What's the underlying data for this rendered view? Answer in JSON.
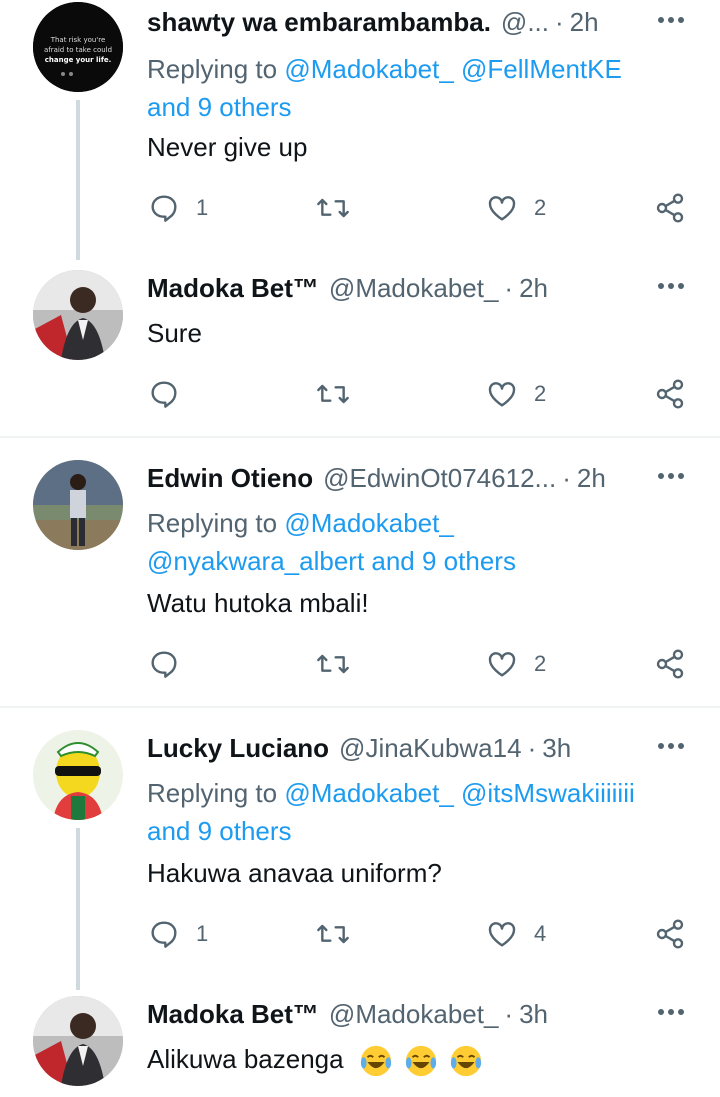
{
  "tweets": [
    {
      "name": "shawty wa embarambamba.",
      "handle": "@...",
      "time": "2h",
      "replying_prefix": "Replying to",
      "replying_line1": "@Madokabet_ @FellMentKE",
      "replying_line2": "and 9 others",
      "text": "Never give up",
      "replies": "1",
      "retweets": "",
      "likes": "2",
      "avatar_text": [
        "That risk you're",
        "afraid to take could",
        "change your life."
      ]
    },
    {
      "name": "Madoka Bet™",
      "handle": "@Madokabet_",
      "time": "2h",
      "text": "Sure",
      "replies": "",
      "retweets": "",
      "likes": "2"
    },
    {
      "name": "Edwin Otieno",
      "handle": "@EdwinOt074612...",
      "time": "2h",
      "replying_prefix": "Replying to",
      "replying_line1": "@Madokabet_",
      "replying_line2": "@nyakwara_albert and 9 others",
      "text": "Watu hutoka mbali!",
      "replies": "",
      "retweets": "",
      "likes": "2"
    },
    {
      "name": "Lucky Luciano",
      "handle": "@JinaKubwa14",
      "time": "3h",
      "replying_prefix": "Replying to",
      "replying_line1": "@Madokabet_ @itsMswakiiiiiii",
      "replying_line2": "and 9 others",
      "text": "Hakuwa anavaa uniform?",
      "replies": "1",
      "retweets": "",
      "likes": "4"
    },
    {
      "name": "Madoka Bet™",
      "handle": "@Madokabet_",
      "time": "3h",
      "text": "Alikuwa bazenga",
      "emoji_count": 3
    }
  ],
  "separator": "·",
  "icons": {
    "reply": "reply-icon",
    "retweet": "retweet-icon",
    "like": "heart-icon",
    "share": "share-icon",
    "more": "more-icon",
    "emoji": "tears-of-joy-icon"
  },
  "colors": {
    "link": "#1d9bf0",
    "muted": "#536471",
    "text": "#0f1419",
    "line": "#cfd9de"
  }
}
